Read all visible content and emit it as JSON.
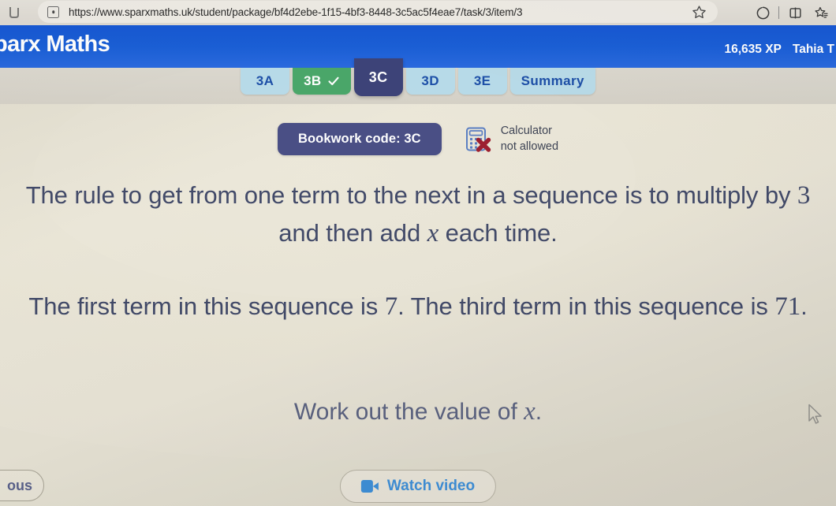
{
  "browser": {
    "url": "https://www.sparxmaths.uk/student/package/bf4d2ebe-1f15-4bf3-8448-3c5ac5f4eae7/task/3/item/3",
    "tab_icon": "tab-icon",
    "site_icon": "site-info-icon",
    "favorite_icon": "star-icon",
    "toolbar_icons": [
      {
        "name": "copilot-icon"
      },
      {
        "name": "split-screen-icon"
      },
      {
        "name": "collections-icon"
      }
    ]
  },
  "header": {
    "logo": "parx Maths",
    "xp": "16,635 XP",
    "user": "Tahia T"
  },
  "tabs": [
    {
      "label": "3A",
      "state": "available",
      "active": false
    },
    {
      "label": "3B",
      "state": "completed",
      "active": false
    },
    {
      "label": "3C",
      "state": "current",
      "active": true
    },
    {
      "label": "3D",
      "state": "available",
      "active": false
    },
    {
      "label": "3E",
      "state": "available",
      "active": false
    },
    {
      "label": "Summary",
      "state": "available",
      "active": false
    }
  ],
  "toolbar": {
    "bookwork_code": "Bookwork code: 3C",
    "calculator_line1": "Calculator",
    "calculator_line2": "not allowed",
    "calculator_icon": "calculator-not-allowed-icon"
  },
  "question": {
    "para1_pre": "The rule to get from one term to the next in a sequence is to multiply by ",
    "para1_num": "3",
    "para1_mid": " and then add ",
    "para1_var": "x",
    "para1_post": " each time.",
    "para2_pre": "The first term in this sequence is ",
    "para2_num1": "7",
    "para2_mid": ". The third term in this sequence is ",
    "para2_num2": "71",
    "para2_post": ".",
    "instruction_pre": "Work out the value of ",
    "instruction_var": "x",
    "instruction_post": "."
  },
  "footer": {
    "previous_label": "ous",
    "watch_video_label": "Watch video",
    "video_icon": "video-camera-icon"
  },
  "colors": {
    "brand_blue": "#1a5fd8",
    "tab_light": "#b9dcea",
    "tab_done": "#4aa76a",
    "tab_active": "#3d4379",
    "bookwork_pill": "#4a4f86",
    "question_text": "#424a69",
    "link_blue": "#3e8fd8",
    "page_bg": "#e9e5d7"
  }
}
